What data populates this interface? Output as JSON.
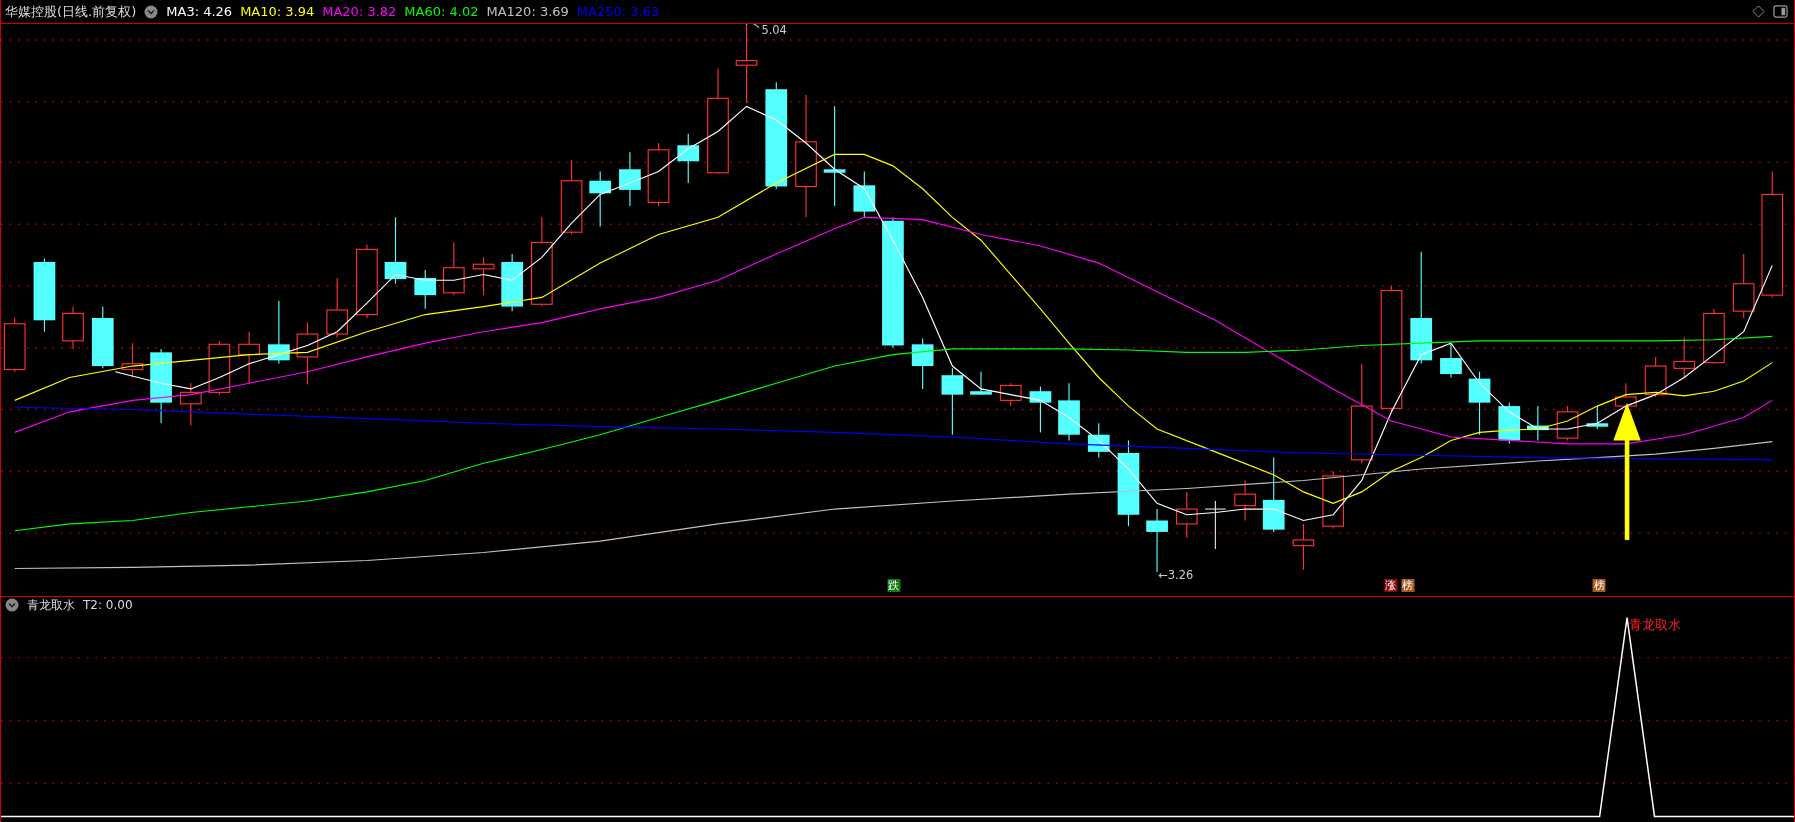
{
  "header": {
    "title": "华媒控股(日线.前复权)",
    "moving_averages": [
      {
        "label": "MA3: 4.26",
        "color": "#ffffff"
      },
      {
        "label": "MA10: 3.94",
        "color": "#ffff00"
      },
      {
        "label": "MA20: 3.82",
        "color": "#ff00ff"
      },
      {
        "label": "MA60: 4.02",
        "color": "#00ff00"
      },
      {
        "label": "MA120: 3.69",
        "color": "#c0c0c0"
      },
      {
        "label": "MA250: 3.63",
        "color": "#0000ff"
      }
    ]
  },
  "main_chart": {
    "high_label": "5.04",
    "low_label": "←3.26",
    "signals": [
      {
        "text": "跌",
        "color": "#137a13"
      },
      {
        "text": "涨",
        "color": "#8b0a0a"
      },
      {
        "text": "榜",
        "color": "#a8561a"
      },
      {
        "text": "榜",
        "color": "#a8561a"
      }
    ]
  },
  "indicator": {
    "name": "青龙取水",
    "reading": "T2: 0.00",
    "signal_label": "青龙取水"
  }
}
